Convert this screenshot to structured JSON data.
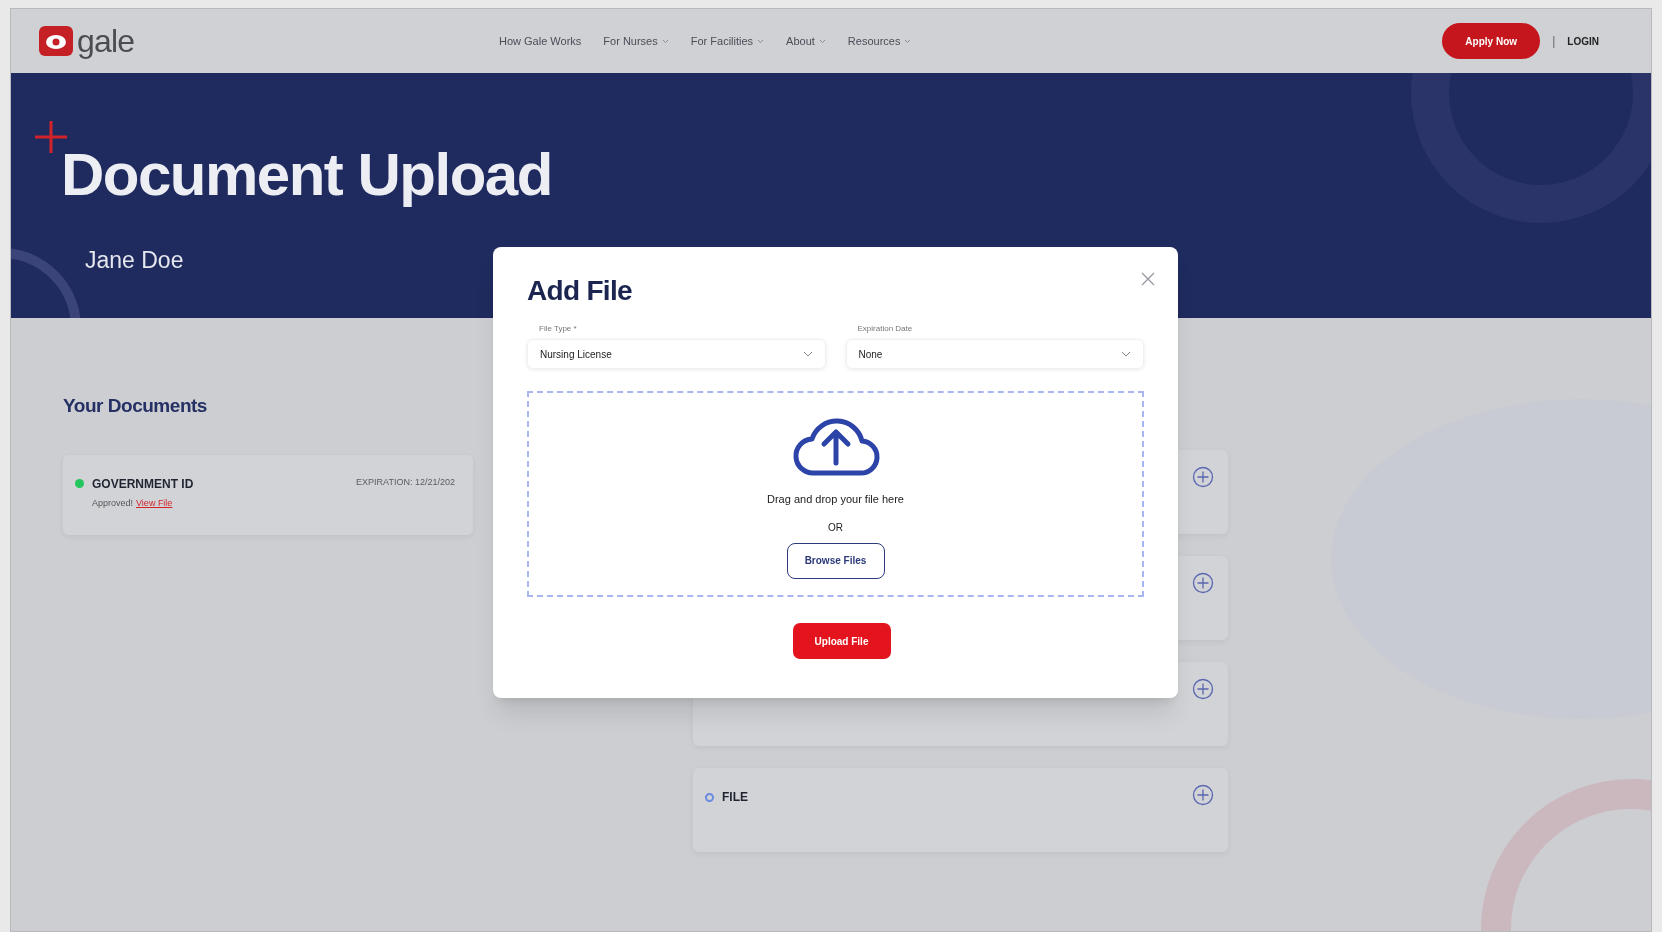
{
  "header": {
    "logo": "gale",
    "nav": [
      {
        "label": "How Gale Works",
        "dropdown": false
      },
      {
        "label": "For Nurses",
        "dropdown": true
      },
      {
        "label": "For Facilities",
        "dropdown": true
      },
      {
        "label": "About",
        "dropdown": true
      },
      {
        "label": "Resources",
        "dropdown": true
      }
    ],
    "apply_button": "Apply Now",
    "separator": "|",
    "login": "LOGIN"
  },
  "hero": {
    "title": "Document Upload",
    "name": "Jane Doe"
  },
  "documents": {
    "heading": "Your Documents",
    "left": [
      {
        "kind": "status",
        "title": "GOVERNMENT ID",
        "filled": true,
        "color": "#22c55e",
        "status": "Approved!",
        "link": "View File",
        "expiration": "EXPIRATION: 12/21/202"
      }
    ],
    "right": [
      {
        "kind": "covered"
      },
      {
        "kind": "covered"
      },
      {
        "kind": "covered"
      },
      {
        "kind": "status",
        "title": "FILE",
        "filled": false,
        "color": "#6b8ae0"
      }
    ]
  },
  "modal": {
    "title": "Add File",
    "fields": [
      {
        "label": "File Type *",
        "value": "Nursing License"
      },
      {
        "label": "Expiration Date",
        "value": "None"
      }
    ],
    "drop_text": "Drag and drop your file here",
    "or": "OR",
    "browse_button": "Browse Files",
    "upload_button": "Upload File"
  }
}
